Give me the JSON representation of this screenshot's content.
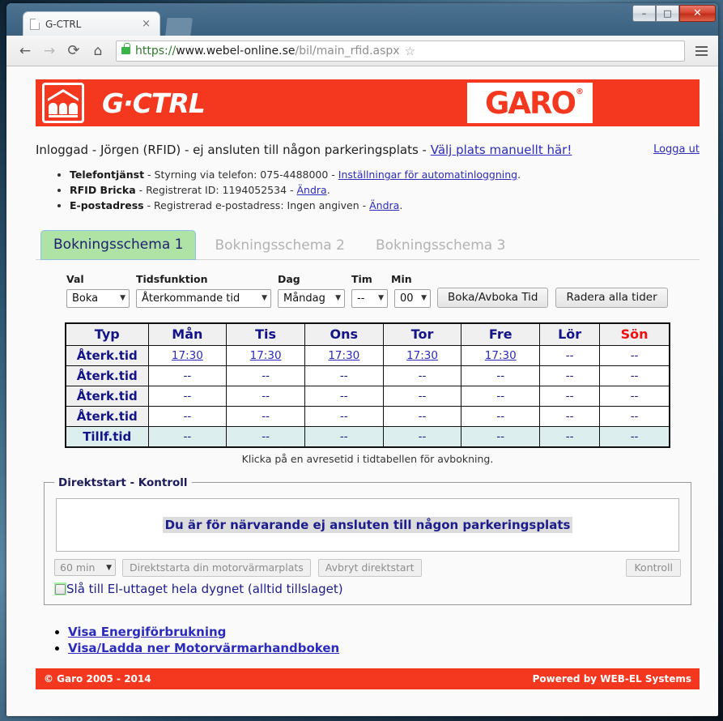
{
  "browser": {
    "tab_title": "G-CTRL",
    "tab_close": "×",
    "back_icon": "←",
    "forward_icon": "→",
    "reload_icon": "⟳",
    "home_icon": "⌂",
    "url_scheme": "https://",
    "url_host": "www.webel-online.se",
    "url_path": "/bil/main_rfid.aspx",
    "bookmark_icon": "☆",
    "minimize_label": "–",
    "maximize_label": "□",
    "close_label": "✕"
  },
  "banner": {
    "brand": "G·CTRL",
    "partner": "GARO",
    "registered": "®"
  },
  "login": {
    "text": "Inloggad - Jörgen (RFID) - ej ansluten till någon parkeringsplats - ",
    "choose_place_link": "Välj plats manuellt här!",
    "logout_link": "Logga ut"
  },
  "info": [
    {
      "title": "Telefontjänst",
      "mid": " - Styrning via telefon: 075-4488000 - ",
      "link": "Inställningar för automatinloggning",
      "tail": "."
    },
    {
      "title": "RFID Bricka",
      "mid": " - Registrerat ID: 1194052534 - ",
      "link": "Ändra",
      "tail": "."
    },
    {
      "title": "E-postadress",
      "mid": " - Registrerad e-postadress: Ingen angiven - ",
      "link": "Ändra",
      "tail": "."
    }
  ],
  "tabs": [
    {
      "label": "Bokningsschema 1",
      "active": true
    },
    {
      "label": "Bokningsschema 2",
      "active": false
    },
    {
      "label": "Bokningsschema 3",
      "active": false
    }
  ],
  "form": {
    "labels": {
      "val": "Val",
      "tidsfunktion": "Tidsfunktion",
      "dag": "Dag",
      "tim": "Tim",
      "min": "Min"
    },
    "values": {
      "val": "Boka",
      "tidsfunktion": "Återkommande tid",
      "dag": "Måndag",
      "tim": "--",
      "min": "00"
    },
    "caret": "▼",
    "book_button": "Boka/Avboka Tid",
    "clear_button": "Radera alla tider"
  },
  "schedule": {
    "headers": [
      "Typ",
      "Mån",
      "Tis",
      "Ons",
      "Tor",
      "Fre",
      "Lör",
      "Sön"
    ],
    "sunday_color": "#f01010",
    "empty": "--",
    "rows": [
      {
        "typ": "Återk.tid",
        "cells": [
          "17:30",
          "17:30",
          "17:30",
          "17:30",
          "17:30",
          "--",
          "--"
        ],
        "linked": true,
        "highlight": false
      },
      {
        "typ": "Återk.tid",
        "cells": [
          "--",
          "--",
          "--",
          "--",
          "--",
          "--",
          "--"
        ],
        "linked": false,
        "highlight": false
      },
      {
        "typ": "Återk.tid",
        "cells": [
          "--",
          "--",
          "--",
          "--",
          "--",
          "--",
          "--"
        ],
        "linked": false,
        "highlight": false
      },
      {
        "typ": "Återk.tid",
        "cells": [
          "--",
          "--",
          "--",
          "--",
          "--",
          "--",
          "--"
        ],
        "linked": false,
        "highlight": false
      },
      {
        "typ": "Tillf.tid",
        "cells": [
          "--",
          "--",
          "--",
          "--",
          "--",
          "--",
          "--"
        ],
        "linked": false,
        "highlight": true
      }
    ],
    "note": "Klicka på en avresetid i tidtabellen för avbokning."
  },
  "direktstart": {
    "legend": "Direktstart - Kontroll",
    "message": "Du är för närvarande ej ansluten till någon parkeringsplats",
    "duration": "60 min",
    "duration_caret": "▼",
    "start_button": "Direktstarta din motorvärmarplats",
    "abort_button": "Avbryt direktstart",
    "kontroll_button": "Kontroll",
    "checkbox_label": "Slå till El-uttaget hela dygnet (alltid tillslaget)",
    "checkbox_checked": false
  },
  "bottom_links": [
    "Visa Energiförbrukning",
    "Visa/Ladda ner Motorvärmarhandboken"
  ],
  "footer": {
    "copyright": "© Garo 2005 - 2014",
    "powered": "Powered by WEB-EL Systems"
  }
}
